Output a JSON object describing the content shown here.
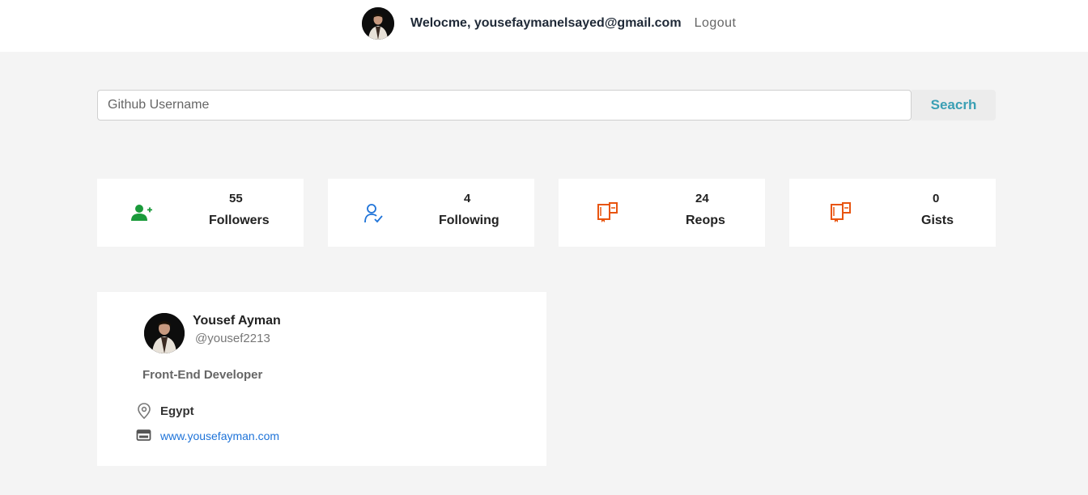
{
  "header": {
    "welcome_text": "Welocme, yousefaymanelsayed@gmail.com",
    "logout_label": "Logout"
  },
  "search": {
    "placeholder": "Github Username",
    "value": "",
    "button_label": "Seacrh",
    "button_color": "#3a9fb4"
  },
  "stats": [
    {
      "value": "55",
      "label": "Followers",
      "icon": "add-user-icon",
      "color": "#1a9a3a"
    },
    {
      "value": "4",
      "label": "Following",
      "icon": "user-check-icon",
      "color": "#1e73d8"
    },
    {
      "value": "24",
      "label": "Reops",
      "icon": "repo-book-icon",
      "color": "#e8540f"
    },
    {
      "value": "0",
      "label": "Gists",
      "icon": "gist-book-icon",
      "color": "#e8540f"
    }
  ],
  "profile": {
    "name": "Yousef Ayman",
    "handle": "@yousef2213",
    "bio": "Front-End Developer",
    "location": "Egypt",
    "website": "www.yousefayman.com",
    "link_color": "#1e73d8"
  }
}
